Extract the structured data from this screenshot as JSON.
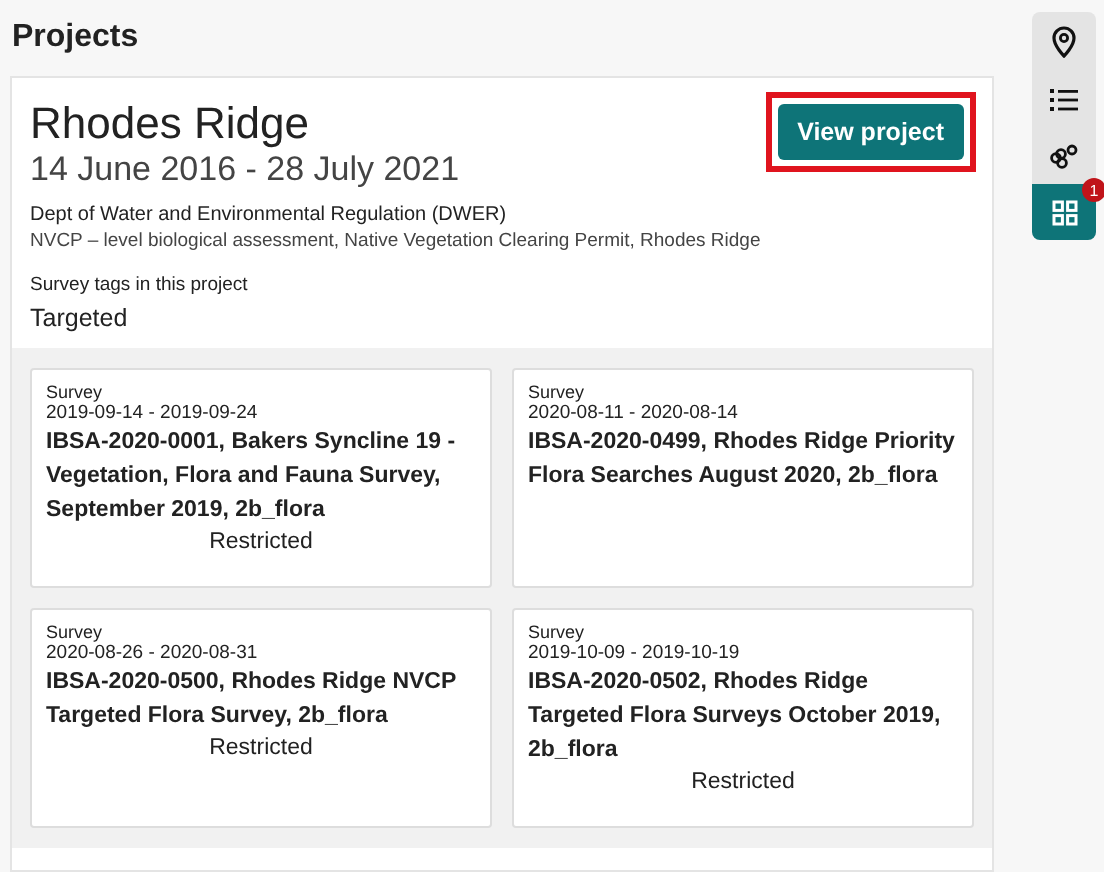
{
  "page_title": "Projects",
  "project": {
    "name": "Rhodes Ridge",
    "dates": "14 June 2016 - 28 July 2021",
    "agency": "Dept of Water and Environmental Regulation (DWER)",
    "description": "NVCP – level biological assessment, Native Vegetation Clearing Permit, Rhodes Ridge",
    "tags_label": "Survey tags in this project",
    "tags": "Targeted",
    "button": {
      "label": "View project",
      "highlighted": true
    }
  },
  "surveys": [
    {
      "type": "Survey",
      "dates": "2019-09-14 - 2019-09-24",
      "title": "IBSA-2020-0001, Bakers Syncline 19 - Vegetation, Flora and Fauna Survey, September 2019, 2b_flora",
      "access": "Restricted"
    },
    {
      "type": "Survey",
      "dates": "2020-08-11 - 2020-08-14",
      "title": "IBSA-2020-0499, Rhodes Ridge Priority Flora Searches August 2020, 2b_flora"
    },
    {
      "type": "Survey",
      "dates": "2020-08-26 - 2020-08-31",
      "title": "IBSA-2020-0500, Rhodes Ridge NVCP Targeted Flora Survey, 2b_flora",
      "access": "Restricted"
    },
    {
      "type": "Survey",
      "dates": "2019-10-09 - 2019-10-19",
      "title": "IBSA-2020-0502, Rhodes Ridge Targeted Flora Surveys October 2019, 2b_flora",
      "access": "Restricted"
    }
  ],
  "rail": [
    {
      "kind": "pin",
      "selected": false
    },
    {
      "kind": "list",
      "selected": false
    },
    {
      "kind": "flora",
      "selected": false
    },
    {
      "kind": "grid",
      "selected": true,
      "badge": "1"
    }
  ]
}
